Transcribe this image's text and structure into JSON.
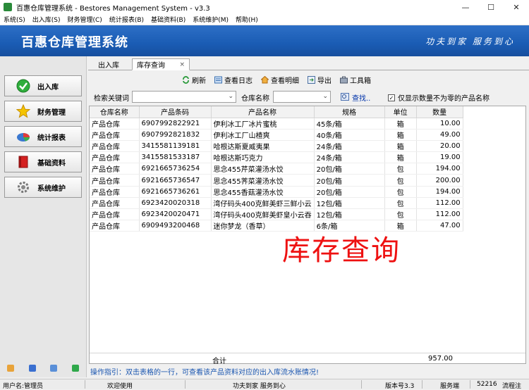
{
  "window": {
    "title": "百惠仓库管理系统 - Bestores Management System - v3.3",
    "controls": [
      "—",
      "☐",
      "✕"
    ]
  },
  "menu": [
    "系统(S)",
    "出入库(S)",
    "财务管理(C)",
    "统计报表(B)",
    "基础资料(B)",
    "系统维护(M)",
    "帮助(H)"
  ],
  "banner": {
    "title": "百惠仓库管理系统",
    "slogan": "功夫到家 服务到心"
  },
  "sidebar": [
    {
      "label": "出入库",
      "icon": "check-circle-icon"
    },
    {
      "label": "财务管理",
      "icon": "star-icon"
    },
    {
      "label": "统计报表",
      "icon": "pie-chart-icon"
    },
    {
      "label": "基础资料",
      "icon": "book-icon"
    },
    {
      "label": "系统维护",
      "icon": "gear-icon"
    }
  ],
  "tabs": {
    "t1": "出入库",
    "t2": "库存查询",
    "close": "×"
  },
  "toolbar": [
    {
      "label": "刷新",
      "icon": "refresh-icon"
    },
    {
      "label": "查看日志",
      "icon": "log-icon"
    },
    {
      "label": "查看明细",
      "icon": "house-icon"
    },
    {
      "label": "导出",
      "icon": "export-icon"
    },
    {
      "label": "工具箱",
      "icon": "toolbox-icon"
    }
  ],
  "search": {
    "keyword_label": "检索关键词",
    "keyword_value": "",
    "warehouse_label": "仓库名称",
    "warehouse_value": "",
    "search_link": "查找..",
    "nonzero_label": "仅显示数量不为零的产品名称",
    "nonzero_checked": "✓"
  },
  "table": {
    "headers": [
      "仓库名称",
      "产品条码",
      "产品名称",
      "规格",
      "单位",
      "数量"
    ],
    "rows": [
      [
        "产品仓库",
        "6907992822921",
        "伊利冰工厂冰片蜜桃",
        "45条/箱",
        "箱",
        "10.00"
      ],
      [
        "产品仓库",
        "6907992821832",
        "伊利冰工厂山楂爽",
        "40条/箱",
        "箱",
        "49.00"
      ],
      [
        "产品仓库",
        "3415581139181",
        "哈根达斯夏威夷果",
        "24条/箱",
        "箱",
        "20.00"
      ],
      [
        "产品仓库",
        "3415581533187",
        "哈根达斯巧克力",
        "24条/箱",
        "箱",
        "19.00"
      ],
      [
        "产品仓库",
        "6921665736254",
        "思念455芹菜灌汤水饺",
        "20包/箱",
        "包",
        "194.00"
      ],
      [
        "产品仓库",
        "6921665736547",
        "思念455荠菜灌汤水饺",
        "20包/箱",
        "包",
        "200.00"
      ],
      [
        "产品仓库",
        "6921665736261",
        "思念455香菇灌汤水饺",
        "20包/箱",
        "包",
        "194.00"
      ],
      [
        "产品仓库",
        "6923420020318",
        "湾仔码头400克鲜美虾三鲜小云",
        "12包/箱",
        "包",
        "112.00"
      ],
      [
        "产品仓库",
        "6923420020471",
        "湾仔码头400克鲜美虾皇小云吞",
        "12包/箱",
        "包",
        "112.00"
      ],
      [
        "产品仓库",
        "6909493200468",
        "迷你梦龙（香草）",
        "6条/箱",
        "箱",
        "47.00"
      ]
    ],
    "total_label": "合计",
    "total_qty": "957.00"
  },
  "overlay": "库存查询",
  "hint": "操作指引：双击表格的一行，可查看该产品资料对应的出入库流水账情况!",
  "status": {
    "user": "用户名:管理员",
    "welcome": "欢迎使用",
    "slogan": "功夫到家 服务到心",
    "version": "版本号3.3",
    "server": "服务端",
    "port": "52216",
    "flow": "流程注"
  }
}
